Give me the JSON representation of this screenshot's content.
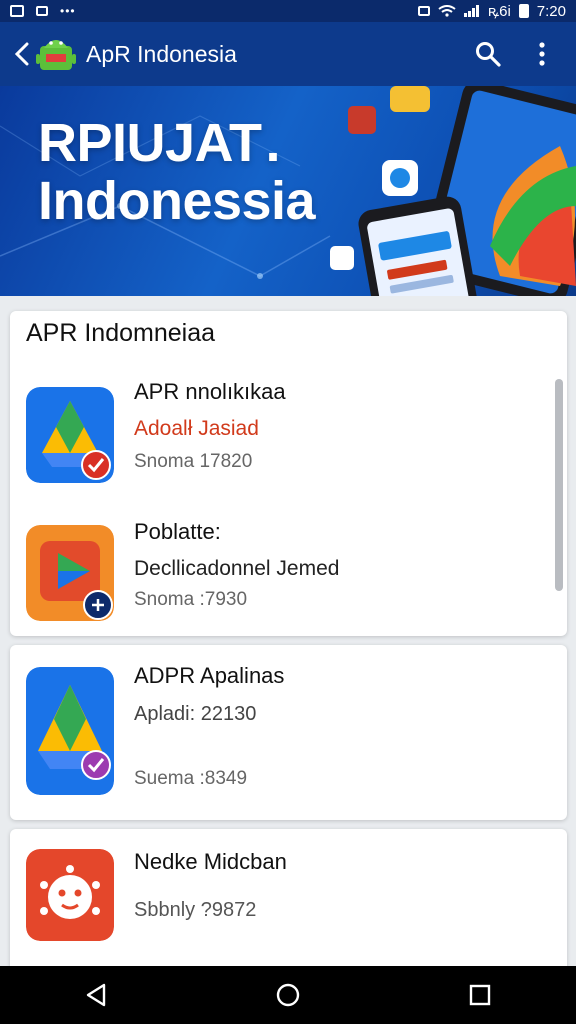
{
  "status_bar": {
    "time": "7:20",
    "indicator_dots": "•••",
    "carrier_text": "ꝶ6i"
  },
  "app_bar": {
    "title": "ApR Indonesia",
    "icons": [
      "back-arrow-icon",
      "android-icon",
      "search-icon",
      "more-vert-icon"
    ]
  },
  "banner": {
    "line1": "RPIUJAT .",
    "line2": "Indonessia"
  },
  "cards": [
    {
      "header": "APR Indomneiaa",
      "items": [
        {
          "title": "APR nnolıkıkaa",
          "subtitle": "Adoalł Jasiad",
          "meta": "Snoma 17820",
          "icon": "drive-triangle-icon"
        },
        {
          "title": "Poblatte:",
          "subtitle": "Decllicadonnel Jemed",
          "meta": "Snoma :7930",
          "icon": "play-store-icon"
        }
      ]
    },
    {
      "items": [
        {
          "title": "ADPR Apalinas",
          "subtitle": "Apladi: 22130",
          "meta": "Suema :8349",
          "icon": "drive-triangle-icon"
        }
      ]
    },
    {
      "items": [
        {
          "title": "Nedke Midcban",
          "subtitle": "Sbbnly ?9872",
          "icon": "robot-face-icon"
        }
      ]
    }
  ],
  "colors": {
    "primary": "#0d3a8c",
    "accent_red": "#d13a1b",
    "background": "#e9ecef"
  }
}
